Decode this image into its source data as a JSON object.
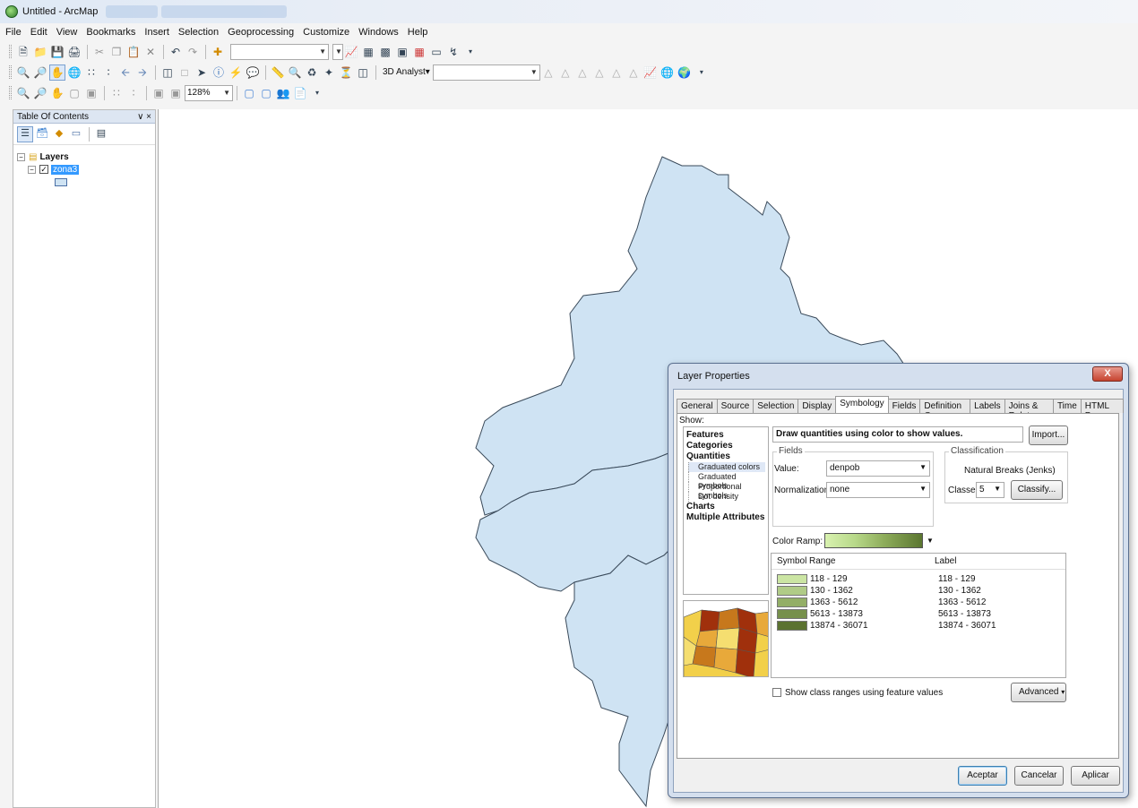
{
  "window": {
    "title": "Untitled - ArcMap"
  },
  "menu": [
    "File",
    "Edit",
    "View",
    "Bookmarks",
    "Insert",
    "Selection",
    "Geoprocessing",
    "Customize",
    "Windows",
    "Help"
  ],
  "toolbar": {
    "extension_label": "3D Analyst▾",
    "zoom_value": "128%"
  },
  "toc": {
    "title": "Table Of Contents",
    "pin": "p ×",
    "root_label": "Layers",
    "layer_label": "zona3"
  },
  "dialog": {
    "title": "Layer Properties",
    "close_label": "X",
    "tabs": [
      "General",
      "Source",
      "Selection",
      "Display",
      "Symbology",
      "Fields",
      "Definition Query",
      "Labels",
      "Joins & Relates",
      "Time",
      "HTML Popup"
    ],
    "active_tab": "Symbology",
    "show_label": "Show:",
    "show_items": {
      "features": "Features",
      "categories": "Categories",
      "quantities": "Quantities",
      "graduated_colors": "Graduated colors",
      "graduated_symbols": "Graduated symbols",
      "proportional_symbols": "Proportional symbols",
      "dot_density": "Dot density",
      "charts": "Charts",
      "multiple_attributes": "Multiple Attributes"
    },
    "description": "Draw quantities using color to show values.",
    "import_label": "Import...",
    "fields_label": "Fields",
    "value_label": "Value:",
    "value": "denpob",
    "normalization_label": "Normalization:",
    "normalization": "none",
    "classification_label": "Classification",
    "classification_method": "Natural Breaks (Jenks)",
    "classes_label": "Classes:",
    "classes_value": "5",
    "classify_label": "Classify...",
    "color_ramp_label": "Color Ramp:",
    "columns": {
      "symbol": "Symbol",
      "range": "Range",
      "label": "Label"
    },
    "classes": [
      {
        "range": "118 - 129",
        "label": "118 - 129",
        "color": "#cbe5a3"
      },
      {
        "range": "130 - 1362",
        "label": "130 - 1362",
        "color": "#b0cb87"
      },
      {
        "range": "1363 - 5612",
        "label": "1363 - 5612",
        "color": "#93ae67"
      },
      {
        "range": "5613 - 13873",
        "label": "5613 - 13873",
        "color": "#76904b"
      },
      {
        "range": "13874 - 36071",
        "label": "13874 - 36071",
        "color": "#5b7230"
      }
    ],
    "show_ranges_label": "Show class ranges using feature values",
    "advanced_label": "Advanced",
    "ok_label": "Aceptar",
    "cancel_label": "Cancelar",
    "apply_label": "Aplicar"
  },
  "colors": {
    "map_fill": "#cfe3f3",
    "map_stroke": "#3a4a5a",
    "selection": "#3399ff"
  }
}
